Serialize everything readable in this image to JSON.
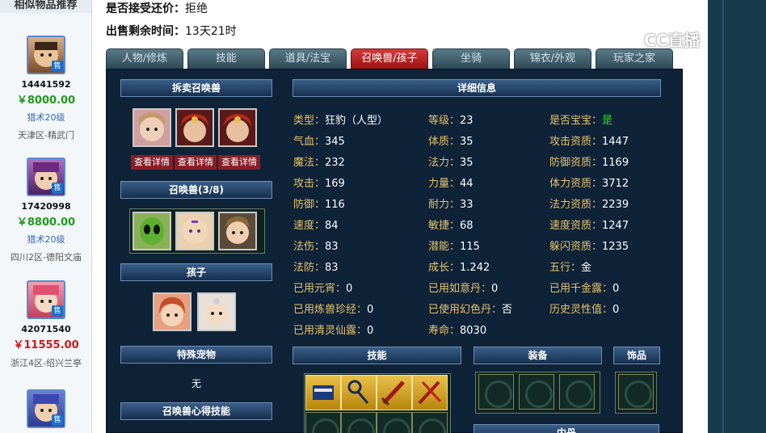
{
  "sidebar": {
    "title": "相似物品推荐",
    "items": [
      {
        "id": "14441592",
        "price": "￥8000.00",
        "level": "猎术20级",
        "server": "天津区-精武门",
        "price_color": "#1e9b1e",
        "badge": "售"
      },
      {
        "id": "17420998",
        "price": "￥8800.00",
        "level": "猎术20级",
        "server": "四川2区-德阳文庙",
        "price_color": "#1e9b1e",
        "badge": "售"
      },
      {
        "id": "42071540",
        "price": "￥11555.00",
        "level": "",
        "server": "浙江4区-绍兴兰亭",
        "price_color": "#d01818",
        "badge": "售"
      },
      {
        "id": "",
        "price": "",
        "level": "",
        "server": "",
        "badge": "售"
      }
    ]
  },
  "info": {
    "counter_offer_label": "是否接受还价：",
    "counter_offer_value": "拒绝",
    "time_left_label": "出售剩余时间：",
    "time_left_value": "13天21时"
  },
  "tabs": [
    "人物/修炼",
    "技能",
    "道具/法宝",
    "召唤兽/孩子",
    "坐骑",
    "锦衣/外观",
    "玩家之家"
  ],
  "active_tab": 3,
  "panel": {
    "split_pet_header": "拆卖召唤兽",
    "detail_header": "详细信息",
    "view_detail": "查看详情",
    "pets_header": "召唤兽(3/8)",
    "children_header": "孩子",
    "special_pet_header": "特殊宠物",
    "special_pet_value": "无",
    "pet_skill_header": "召唤兽心得技能",
    "skills_header": "技能",
    "equipment_header": "装备",
    "ornament_header": "饰品",
    "neidan_header": "内丹"
  },
  "stats": {
    "col1": [
      {
        "label": "类型：",
        "value": "狂豹（人型）"
      },
      {
        "label": "气血：",
        "value": "345"
      },
      {
        "label": "魔法：",
        "value": "232"
      },
      {
        "label": "攻击：",
        "value": "169"
      },
      {
        "label": "防御：",
        "value": "116"
      },
      {
        "label": "速度：",
        "value": "84"
      },
      {
        "label": "法伤：",
        "value": "83"
      },
      {
        "label": "法防：",
        "value": "83"
      },
      {
        "label": "已用元宵：",
        "value": "0"
      },
      {
        "label": "已用炼兽珍经：",
        "value": "0"
      },
      {
        "label": "已用清灵仙露：",
        "value": "0"
      }
    ],
    "col2": [
      {
        "label": "等级：",
        "value": "23"
      },
      {
        "label": "体质：",
        "value": "35"
      },
      {
        "label": "法力：",
        "value": "35"
      },
      {
        "label": "力量：",
        "value": "44"
      },
      {
        "label": "耐力：",
        "value": "33"
      },
      {
        "label": "敏捷：",
        "value": "68"
      },
      {
        "label": "潜能：",
        "value": "115"
      },
      {
        "label": "成长：",
        "value": "1.242"
      },
      {
        "label": "已用如意丹：",
        "value": "0"
      },
      {
        "label": "已使用幻色丹：",
        "value": "否"
      },
      {
        "label": "寿命：",
        "value": "8030"
      }
    ],
    "col3": [
      {
        "label": "是否宝宝：",
        "value": "是",
        "highlight": "green"
      },
      {
        "label": "攻击资质：",
        "value": "1447"
      },
      {
        "label": "防御资质：",
        "value": "1169"
      },
      {
        "label": "体力资质：",
        "value": "3712"
      },
      {
        "label": "法力资质：",
        "value": "2239"
      },
      {
        "label": "速度资质：",
        "value": "1247"
      },
      {
        "label": "躲闪资质：",
        "value": "1235"
      },
      {
        "label": "五行：",
        "value": "金"
      },
      {
        "label": "已用千金露：",
        "value": "0"
      },
      {
        "label": "历史灵性值：",
        "value": "0"
      }
    ]
  },
  "watermark": "CC直播",
  "colors": {
    "panel_bg": "#0e2238",
    "stat_label": "#e8c36a",
    "active_tab": "#c42a2a",
    "price_green": "#1e9b1e",
    "price_red": "#d01818"
  }
}
